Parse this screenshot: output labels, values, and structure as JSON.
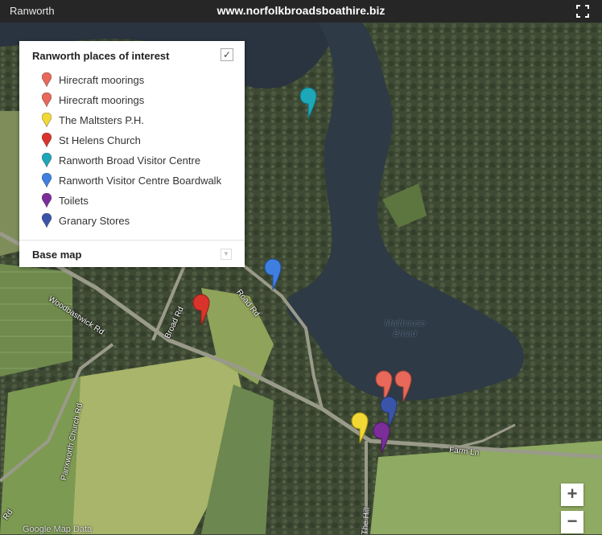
{
  "header": {
    "left_title": "Ranworth",
    "center_url": "www.norfolkbroadsboathire.biz",
    "fullscreen_icon": "fullscreen-icon"
  },
  "panel": {
    "title": "Ranworth places of interest",
    "checked": true,
    "items": [
      {
        "label": "Hirecraft moorings",
        "color": "#e8685a"
      },
      {
        "label": "Hirecraft moorings",
        "color": "#e8685a"
      },
      {
        "label": "The Maltsters P.H.",
        "color": "#f2d835"
      },
      {
        "label": "St Helens Church",
        "color": "#d9342b"
      },
      {
        "label": "Ranworth Broad Visitor Centre",
        "color": "#1ea7b8"
      },
      {
        "label": "Ranworth Visitor Centre Boardwalk",
        "color": "#3f7fe0"
      },
      {
        "label": "Toilets",
        "color": "#7b2e9a"
      },
      {
        "label": "Granary Stores",
        "color": "#3a55a8"
      }
    ],
    "base_map_label": "Base map"
  },
  "map": {
    "water_label_line1": "Malthouse",
    "water_label_line2": "Broad",
    "road_labels": {
      "woodbastwick": "Woodbastwick Rd",
      "broad_rd": "Broad Rd",
      "road_rd": "Road Rd",
      "panxworth": "Panxworth Church Rd",
      "farm_ln": "Farm Ln",
      "the_hill": "The Hill",
      "rd_edge": "Rd"
    },
    "attribution": "Google  Map Data",
    "zoom_in": "+",
    "zoom_out": "−"
  }
}
